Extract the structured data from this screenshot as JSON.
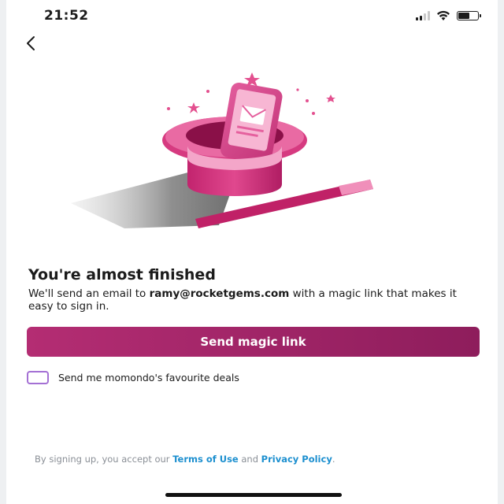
{
  "status_bar": {
    "time": "21:52",
    "icons": [
      "cellular-signal-icon",
      "wifi-icon",
      "battery-icon"
    ]
  },
  "navigation": {
    "back_icon": "chevron-left-icon"
  },
  "illustration": {
    "description_icon": "magic-hat-phone-illustration"
  },
  "content": {
    "heading": "You're almost finished",
    "description_prefix": "We'll send an email to ",
    "email": "ramy@rocketgems.com",
    "description_suffix": " with a magic link that makes it easy to sign in."
  },
  "actions": {
    "send_button_label": "Send magic link"
  },
  "deals_opt_in": {
    "label": "Send me momondo's favourite deals",
    "checked": false
  },
  "legal": {
    "prefix": "By signing up, you accept our ",
    "terms_link": "Terms of Use",
    "conjunction": " and ",
    "privacy_link": "Privacy Policy",
    "suffix": "."
  },
  "colors": {
    "primary": "#b42d73",
    "primary_dark": "#8e1d5c",
    "checkbox_border": "#a470d4",
    "link": "#1c8fcf",
    "muted_text": "#8a8f96"
  }
}
